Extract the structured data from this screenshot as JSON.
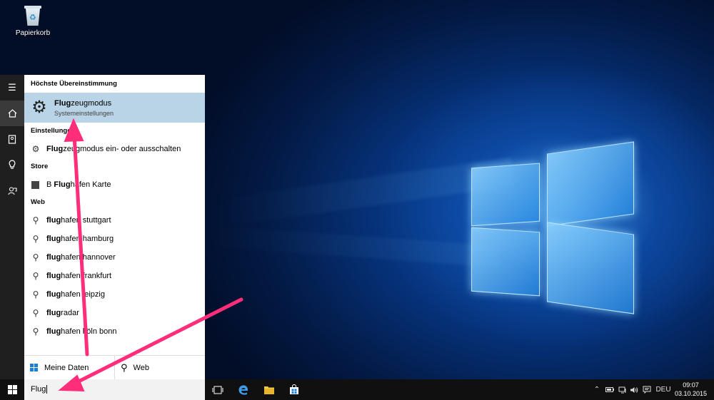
{
  "desktop": {
    "recycle_bin_label": "Papierkorb"
  },
  "rail": {
    "items": [
      "menu-icon",
      "home-icon",
      "notebook-icon",
      "lightbulb-icon",
      "feedback-icon"
    ]
  },
  "search_panel": {
    "best_match": {
      "header": "Höchste Übereinstimmung",
      "title_bold": "Flug",
      "title_rest": "zeugmodus",
      "subtitle": "Systemeinstellungen"
    },
    "settings": {
      "header": "Einstellungen",
      "items": [
        {
          "bold": "Flug",
          "rest": "zeugmodus ein- oder ausschalten"
        }
      ]
    },
    "store": {
      "header": "Store",
      "items": [
        {
          "pre": "B ",
          "bold": "Flug",
          "rest": "hafen Karte"
        }
      ]
    },
    "web": {
      "header": "Web",
      "items": [
        {
          "bold": "flug",
          "rest": "hafen stuttgart"
        },
        {
          "bold": "flug",
          "rest": "hafen hamburg"
        },
        {
          "bold": "flug",
          "rest": "hafen hannover"
        },
        {
          "bold": "flug",
          "rest": "hafen frankfurt"
        },
        {
          "bold": "flug",
          "rest": "hafen leipzig"
        },
        {
          "bold": "flug",
          "rest": "radar"
        },
        {
          "bold": "flug",
          "rest": "hafen köln bonn"
        }
      ]
    },
    "bottom": {
      "my_data_label": "Meine Daten",
      "web_label": "Web"
    }
  },
  "taskbar": {
    "search_value": "Flug",
    "language": "DEU",
    "time": "09:07",
    "date": "03.10.2015",
    "colors": {
      "accent": "#1a7fd4",
      "highlight": "#b8d4e6",
      "arrow": "#ff2d7a"
    }
  }
}
